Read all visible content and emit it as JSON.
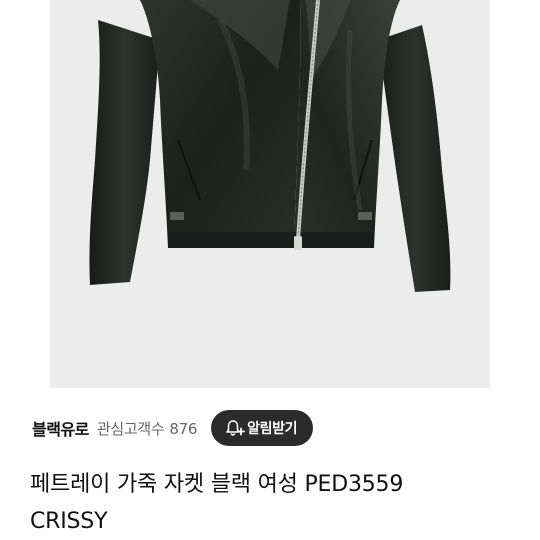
{
  "product": {
    "image_icon": "black-leather-jacket-image",
    "image_bg": "#ececec"
  },
  "brand": {
    "name": "블랙유로",
    "interest_label": "관심고객수",
    "interest_count": "876",
    "alert_label": "알림받기",
    "alert_icon": "bell-plus-icon",
    "alert_bg": "#2b2b2b"
  },
  "title": {
    "line1": "페트레이 가죽 자켓 블랙 여성 PED3559",
    "line2": "CRISSY"
  }
}
